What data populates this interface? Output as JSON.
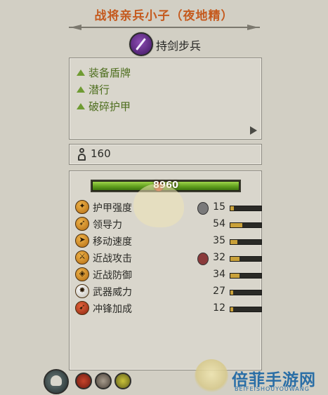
{
  "unit": {
    "title": "战将亲兵小子（夜地精）",
    "class_icon": "sword-icon",
    "class_name": "持剑步兵",
    "class_color": "#5b2a86"
  },
  "abilities": {
    "items": [
      {
        "label": "装备盾牌",
        "icon": "green-triangle-icon"
      },
      {
        "label": "潜行",
        "icon": "green-triangle-icon"
      },
      {
        "label": "破碎护甲",
        "icon": "green-triangle-icon"
      }
    ],
    "accent": "#6f9b32"
  },
  "unit_count": {
    "icon": "soldier-icon",
    "value": "160"
  },
  "health": {
    "value": "8960",
    "fill_fraction": 1.0,
    "color": "#6aa62a"
  },
  "stats": [
    {
      "label": "护甲强度",
      "value": "15",
      "icon": "armor-icon",
      "badge": "shield-icon",
      "fill_fraction": 0.12
    },
    {
      "label": "领导力",
      "value": "54",
      "icon": "leadership-icon",
      "fill_fraction": 0.38
    },
    {
      "label": "移动速度",
      "value": "35",
      "icon": "speed-icon",
      "fill_fraction": 0.22
    },
    {
      "label": "近战攻击",
      "value": "32",
      "icon": "melee-attack-icon",
      "badge": "poison-icon",
      "fill_fraction": 0.3
    },
    {
      "label": "近战防御",
      "value": "34",
      "icon": "melee-defence-icon",
      "fill_fraction": 0.3
    },
    {
      "label": "武器威力",
      "value": "27",
      "icon": "weapon-strength-icon",
      "fill_fraction": 0.1
    },
    {
      "label": "冲锋加成",
      "value": "12",
      "icon": "charge-bonus-icon",
      "fill_fraction": 0.08
    }
  ],
  "bottom_icons": [
    "portrait-skull-icon",
    "rally-icon",
    "war-drum-icon",
    "eye-icon"
  ],
  "watermark": {
    "name": "倍菲手游网",
    "sub": "BEIFEISHOUYOUWANG"
  }
}
